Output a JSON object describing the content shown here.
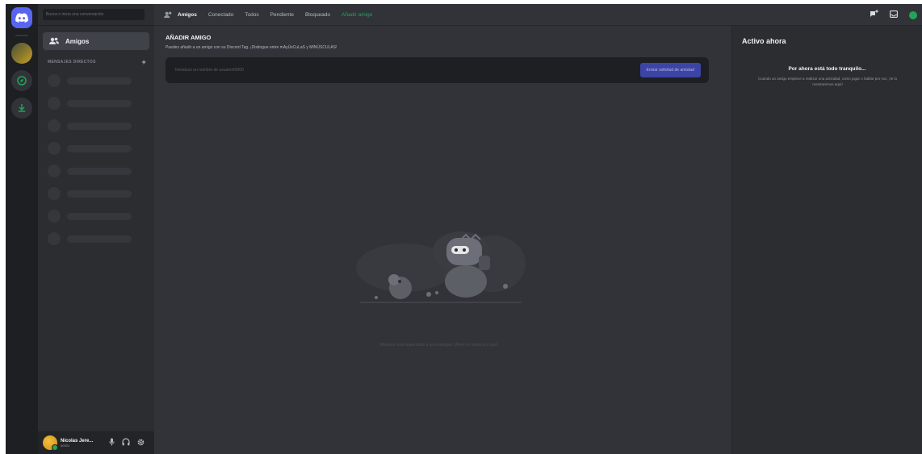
{
  "sidebar": {
    "search_placeholder": "Busca o inicia una conversación",
    "friends_label": "Amigos",
    "dm_header": "MENSAJES DIRECTOS",
    "dm_add": "+"
  },
  "user": {
    "name": "Nicolas Jere...",
    "tag": "#0001"
  },
  "topbar": {
    "title": "Amigos",
    "tabs": [
      "Conectado",
      "Todos",
      "Pendiente",
      "Bloqueado"
    ],
    "add_friend": "Añadir amigo"
  },
  "add_friend": {
    "title": "AÑADIR AMIGO",
    "description": "Puedes añadir a un amigo con su Discord Tag. ¡Distingue entre mAyÚsCuLaS y MINÚSCULAS!",
    "input_placeholder": "Introduce un nombre de usuario#0000",
    "button_label": "Enviar solicitud de amistad"
  },
  "empty_state": {
    "text": "Wumpus está esperando a unos amigos. ¡Pero no tienes por qué!"
  },
  "activity": {
    "title": "Activo ahora",
    "subtitle": "Por ahora está todo tranquilo...",
    "description": "Cuando un amigo empiece a realizar una actividad, como jugar o hablar por voz, ¡te lo mostraremos aquí!"
  },
  "colors": {
    "accent": "#5865f2",
    "online": "#23a559"
  }
}
